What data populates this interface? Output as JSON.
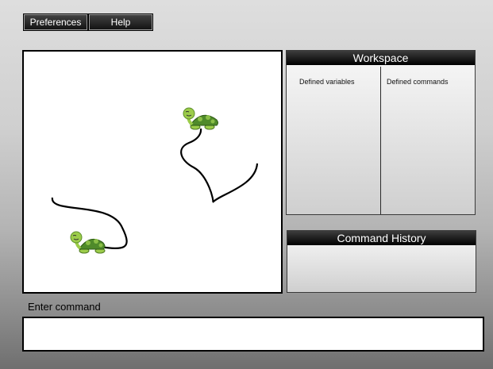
{
  "menu": {
    "preferences_label": "Preferences",
    "help_label": "Help"
  },
  "workspace": {
    "title": "Workspace",
    "defined_variables_label": "Defined variables",
    "defined_commands_label": "Defined commands"
  },
  "history": {
    "title": "Command History"
  },
  "command": {
    "label": "Enter command",
    "value": ""
  },
  "canvas": {
    "turtles": [
      {
        "icon": "turtle-icon"
      },
      {
        "icon": "turtle-icon"
      }
    ]
  },
  "colors": {
    "turtle_shell": "#4f8a2a",
    "turtle_skin": "#9ccc4a",
    "trail": "#000000"
  }
}
